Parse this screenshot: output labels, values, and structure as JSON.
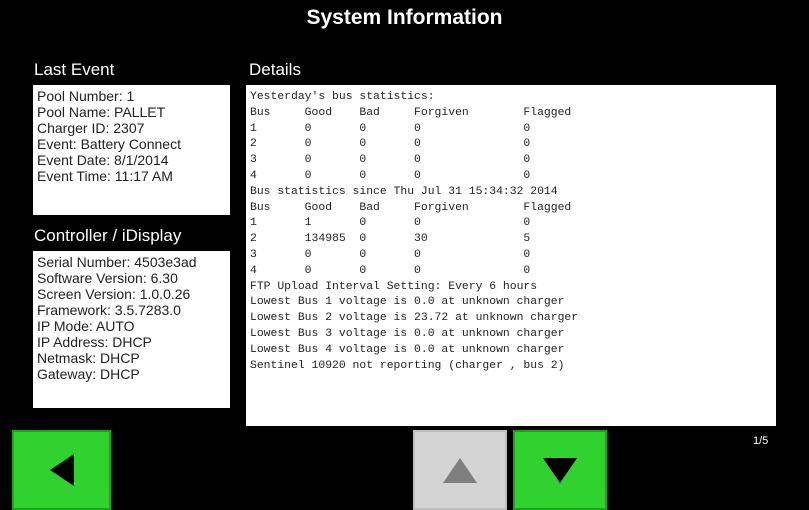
{
  "title": "System Information",
  "last_event": {
    "heading": "Last Event",
    "lines": [
      "Pool Number: 1",
      "Pool Name: PALLET",
      "Charger ID: 2307",
      "Event: Battery Connect",
      "Event Date: 8/1/2014",
      "Event Time: 11:17 AM"
    ]
  },
  "controller": {
    "heading": "Controller / iDisplay",
    "lines": [
      "Serial Number: 4503e3ad",
      "Software Version: 6.30",
      "Screen Version: 1.0.0.26",
      "Framework: 3.5.7283.0",
      "IP Mode: AUTO",
      "IP Address: DHCP",
      "Netmask: DHCP",
      "Gateway: DHCP"
    ]
  },
  "details": {
    "heading": "Details",
    "lines": [
      "Yesterday's bus statistics:",
      "Bus     Good    Bad     Forgiven        Flagged",
      "1       0       0       0               0",
      "2       0       0       0               0",
      "3       0       0       0               0",
      "4       0       0       0               0",
      "Bus statistics since Thu Jul 31 15:34:32 2014",
      "Bus     Good    Bad     Forgiven        Flagged",
      "1       1       0       0               0",
      "2       134985  0       30              5",
      "3       0       0       0               0",
      "4       0       0       0               0",
      "FTP Upload Interval Setting: Every 6 hours",
      "Lowest Bus 1 voltage is 0.0 at unknown charger",
      "Lowest Bus 2 voltage is 23.72 at unknown charger",
      "Lowest Bus 3 voltage is 0.0 at unknown charger",
      "Lowest Bus 4 voltage is 0.0 at unknown charger",
      "Sentinel 10920 not reporting (charger , bus 2)"
    ]
  },
  "page_indicator": "1/5",
  "icons": {
    "back": "left-arrow-icon",
    "scroll_up": "up-arrow-icon",
    "scroll_down": "down-arrow-icon"
  },
  "colors": {
    "button_green": "#2fd22f",
    "button_disabled": "#d4d4d4",
    "background": "#000000"
  }
}
